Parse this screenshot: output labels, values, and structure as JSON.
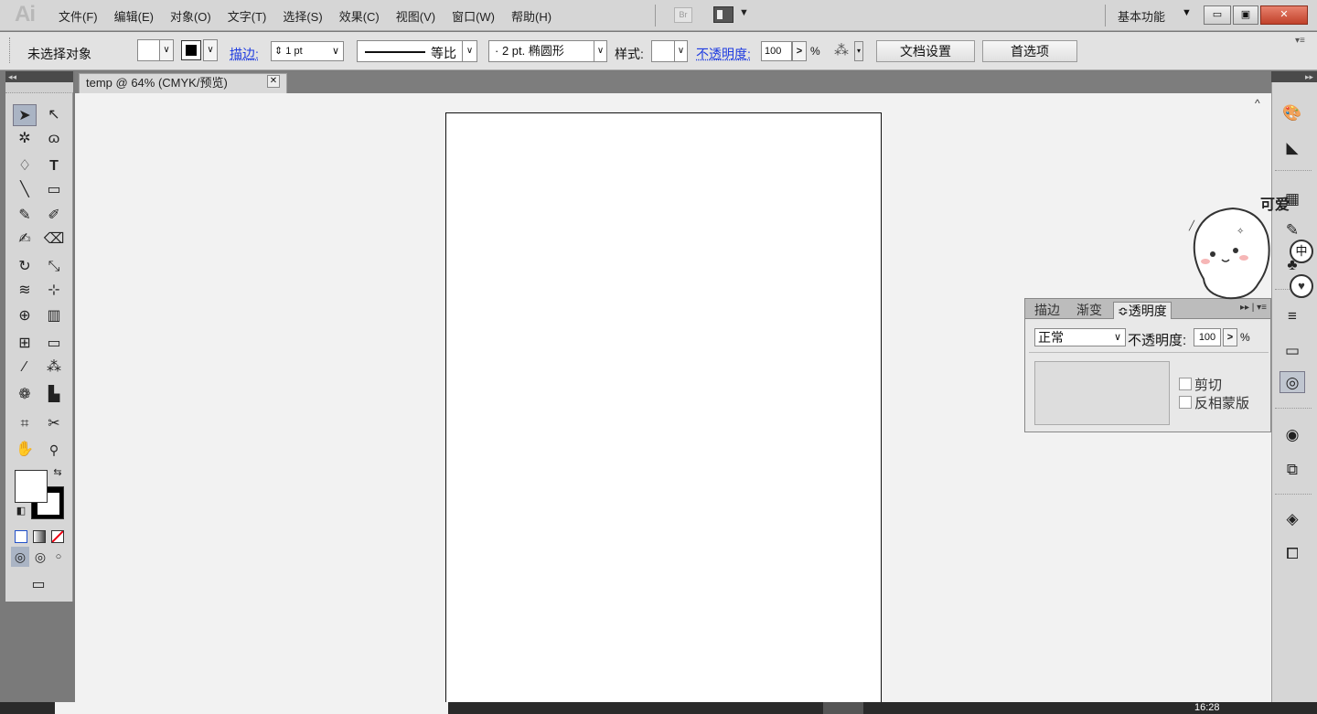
{
  "app": {
    "logo": "Ai"
  },
  "menu": [
    "文件(F)",
    "编辑(E)",
    "对象(O)",
    "文字(T)",
    "选择(S)",
    "效果(C)",
    "视图(V)",
    "窗口(W)",
    "帮助(H)"
  ],
  "bridge": "Br",
  "workspace": "基本功能",
  "control": {
    "selection_label": "未选择对象",
    "stroke_label": "描边:",
    "stroke_weight": "1 pt",
    "profile_label": "等比",
    "brush_label": "· 2 pt. 椭圆形",
    "style_label": "样式:",
    "opacity_label": "不透明度:",
    "opacity_value": "100",
    "opacity_arrow": ">",
    "percent": "%",
    "doc_setup": "文档设置",
    "preferences": "首选项"
  },
  "tab": {
    "title": "temp @ 64% (CMYK/预览)",
    "close": "✕"
  },
  "transparency_panel": {
    "tabs": [
      "描边",
      "渐变",
      "≎透明度"
    ],
    "menu_glyph": "▸▸ | ▾≡",
    "mode": "正常",
    "opacity_label": "不透明度:",
    "opacity_value": "100",
    "opacity_arrow": ">",
    "percent": "%",
    "clip_label": "剪切",
    "invert_label": "反相蒙版"
  },
  "sticker": {
    "text": "可爱",
    "ime1": "中",
    "ime2": "♥"
  },
  "taskbar": {
    "clock": "16:28"
  },
  "icons": {
    "selection": "▲",
    "direct_selection": "▵",
    "magic_wand": "✲",
    "lasso": "ɷ",
    "pen": "♢",
    "type": "T",
    "line": "╲",
    "rect": "▭",
    "brush": "✎",
    "pencil": "✐",
    "blob": "✍",
    "eraser": "⌫",
    "rotate": "↻",
    "scale": "⤡",
    "warp": "≋",
    "free_transform": "⊹",
    "shape_builder": "⊕",
    "perspective": "▥",
    "mesh": "⊞",
    "gradient": "▭",
    "eyedropper": "⁄",
    "blend": "⁂",
    "symbol_spray": "❁",
    "graph": "▙",
    "artboard": "⌗",
    "slice": "✂",
    "hand": "✋",
    "zoom": "🔍",
    "swap": "⇆",
    "default": "◧"
  }
}
